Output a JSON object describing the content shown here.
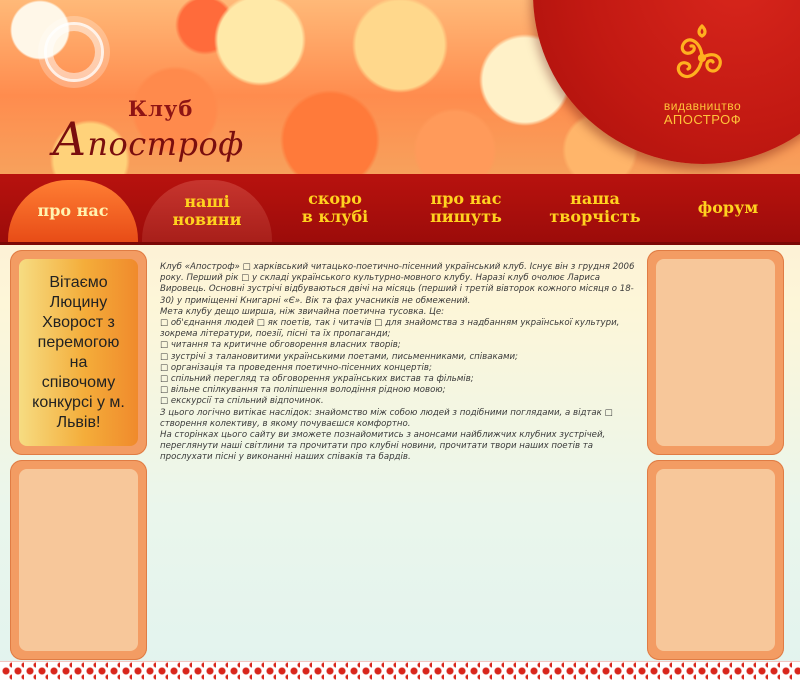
{
  "header": {
    "logo_top": "Клуб",
    "logo_main": "Апостроф",
    "brand_line1": "видавництво",
    "brand_line2": "АПОСТРОФ"
  },
  "nav": [
    {
      "label": "про нас"
    },
    {
      "label": "наші\nновини"
    },
    {
      "label": "скоро\nв клубі"
    },
    {
      "label": "про нас\nпишуть"
    },
    {
      "label": "наша\nтворчість"
    },
    {
      "label": "форум"
    }
  ],
  "sidebar_left": {
    "welcome": "Вітаємо Люцину Хворост з перемогою на співочому конкурсі у м. Львів!"
  },
  "content": {
    "paragraphs": [
      "Клуб «Апостроф» □ харківський читацько-поетично-пісенний український клуб. Існує він з грудня 2006 року. Перший рік □ у складі українського культурно-мовного клубу. Наразі клуб очолює Лариса Вировець. Основні зустрічі відбуваються двічі на місяць (перший і третій вівторок кожного місяця о 18-30) у приміщенні Книгарні «Є». Вік та фах учасників не обмежений.",
      "Мета клубу дещо ширша, ніж звичайна поетична тусовка. Це:",
      "□      об'єднання людей □ як поетів, так і читачів □ для знайомства з надбанням української культури, зокрема літератури, поезії, пісні та їх пропаганди;",
      "□ читання та критичне обговорення власних творів;",
      "□ зустрічі з талановитими українськими поетами, письменниками, співаками;",
      "□ організація та проведення поетично-пісенних концертів;",
      "□ спільний перегляд та обговорення українських вистав та фільмів;",
      "□ вільне спілкування та поліпшення володіння рідною мовою;",
      "□ екскурсії та спільний відпочинок.",
      "З цього логічно витікає наслідок: знайомство між собою людей з подібними поглядами, а відтак □ створення колективу, в якому почуваєшся комфортно.",
      "На сторінках цього сайту ви зможете познайомитись з анонсами найближчих клубних зустрічей, переглянути наші світлини та прочитати про клубні новини, прочитати твори наших поетів та прослухати пісні у виконанні наших співаків та бардів."
    ]
  }
}
